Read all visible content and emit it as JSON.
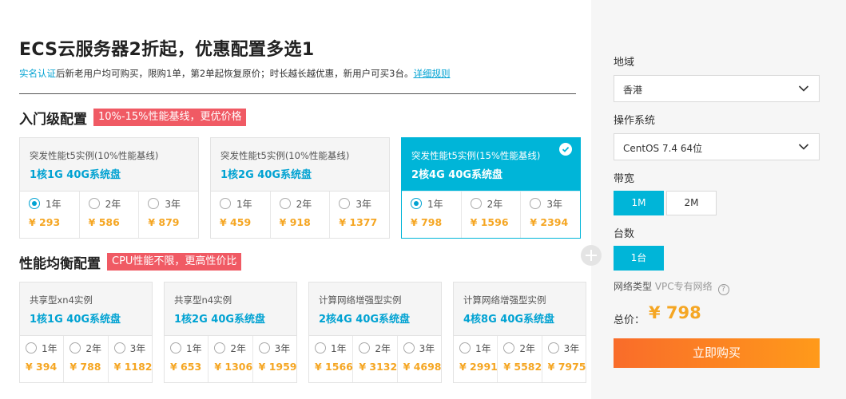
{
  "header": {
    "title": "ECS云服务器2折起，优惠配置多选1",
    "notice_prefix": "实名认证",
    "notice_text": "后新老用户均可购买，限购1单，第2单起恢复原价；时长越长越优惠，新用户可买3台。",
    "notice_link": "详细规则"
  },
  "entry_section": {
    "title": "入门级配置",
    "tag": "10%-15%性能基线，更优价格",
    "cards": [
      {
        "subtitle": "突发性能t5实例(10%性能基线)",
        "spec": "1核1G 40G系统盘",
        "options": [
          {
            "year": "1年",
            "price": "¥ 293"
          },
          {
            "year": "2年",
            "price": "¥ 586"
          },
          {
            "year": "3年",
            "price": "¥ 879"
          }
        ]
      },
      {
        "subtitle": "突发性能t5实例(10%性能基线)",
        "spec": "1核2G 40G系统盘",
        "options": [
          {
            "year": "1年",
            "price": "¥ 459"
          },
          {
            "year": "2年",
            "price": "¥ 918"
          },
          {
            "year": "3年",
            "price": "¥ 1377"
          }
        ]
      },
      {
        "subtitle": "突发性能t5实例(15%性能基线)",
        "spec": "2核4G 40G系统盘",
        "options": [
          {
            "year": "1年",
            "price": "¥ 798"
          },
          {
            "year": "2年",
            "price": "¥ 1596"
          },
          {
            "year": "3年",
            "price": "¥ 2394"
          }
        ]
      }
    ]
  },
  "balanced_section": {
    "title": "性能均衡配置",
    "tag": "CPU性能不限，更高性价比",
    "cards": [
      {
        "subtitle": "共享型xn4实例",
        "spec": "1核1G 40G系统盘",
        "options": [
          {
            "year": "1年",
            "price": "¥ 394"
          },
          {
            "year": "2年",
            "price": "¥ 788"
          },
          {
            "year": "3年",
            "price": "¥ 1182"
          }
        ]
      },
      {
        "subtitle": "共享型n4实例",
        "spec": "1核2G 40G系统盘",
        "options": [
          {
            "year": "1年",
            "price": "¥ 653"
          },
          {
            "year": "2年",
            "price": "¥ 1306"
          },
          {
            "year": "3年",
            "price": "¥ 1959"
          }
        ]
      },
      {
        "subtitle": "计算网络增强型实例",
        "spec": "2核4G 40G系统盘",
        "options": [
          {
            "year": "1年",
            "price": "¥ 1566"
          },
          {
            "year": "2年",
            "price": "¥ 3132"
          },
          {
            "year": "3年",
            "price": "¥ 4698"
          }
        ]
      },
      {
        "subtitle": "计算网络增强型实例",
        "spec": "4核8G 40G系统盘",
        "options": [
          {
            "year": "1年",
            "price": "¥ 2991"
          },
          {
            "year": "2年",
            "price": "¥ 5582"
          },
          {
            "year": "3年",
            "price": "¥ 7975"
          }
        ]
      }
    ]
  },
  "sidebar": {
    "region_label": "地域",
    "region_value": "香港",
    "os_label": "操作系统",
    "os_value": "CentOS 7.4 64位",
    "bandwidth_label": "带宽",
    "bandwidth_options": [
      "1M",
      "2M"
    ],
    "count_label": "台数",
    "count_value": "1台",
    "network_label": "网络类型",
    "network_value": "VPC专有网络",
    "help_glyph": "?",
    "total_label": "总价：",
    "total_value": "¥ 798",
    "buy_label": "立即购买"
  },
  "colors": {
    "accent": "#00b5d8",
    "link": "#00a2d2",
    "price": "#f5a623",
    "tag": "#f05a64",
    "buy_start": "#f96c2a",
    "buy_end": "#ff9a1a"
  }
}
